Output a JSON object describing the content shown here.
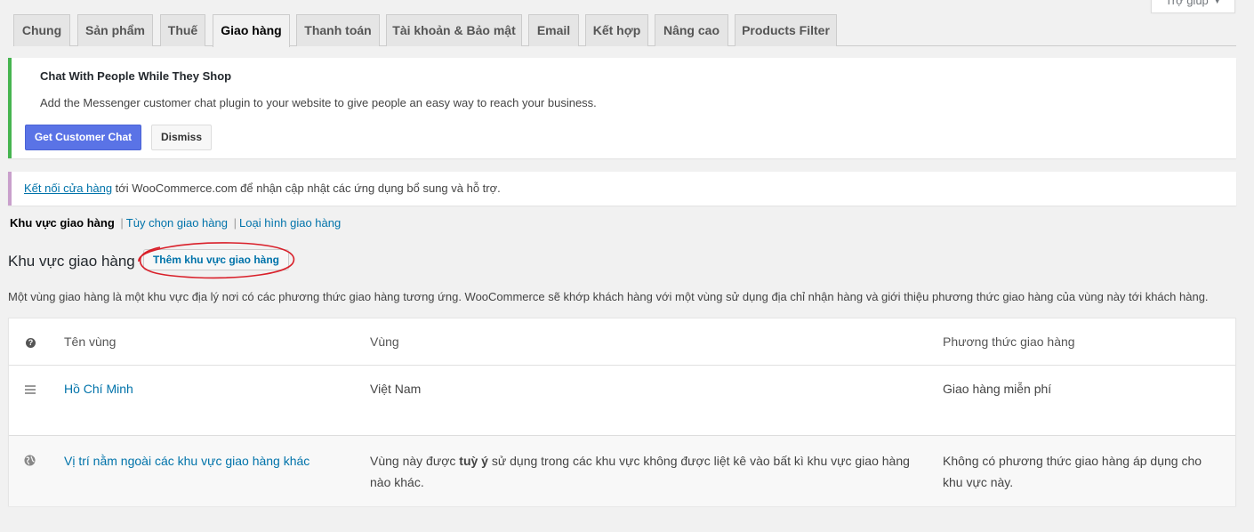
{
  "help_tab": {
    "label": "Trợ giúp"
  },
  "tabs": [
    {
      "label": "Chung",
      "active": false
    },
    {
      "label": "Sản phẩm",
      "active": false
    },
    {
      "label": "Thuế",
      "active": false
    },
    {
      "label": "Giao hàng",
      "active": true
    },
    {
      "label": "Thanh toán",
      "active": false
    },
    {
      "label": "Tài khoản & Bảo mật",
      "active": false
    },
    {
      "label": "Email",
      "active": false
    },
    {
      "label": "Kết hợp",
      "active": false
    },
    {
      "label": "Nâng cao",
      "active": false
    },
    {
      "label": "Products Filter",
      "active": false
    }
  ],
  "messenger_notice": {
    "title": "Chat With People While They Shop",
    "text": "Add the Messenger customer chat plugin to your website to give people an easy way to reach your business.",
    "primary_button": "Get Customer Chat",
    "dismiss_button": "Dismiss"
  },
  "connect_notice": {
    "link_text": "Kết nối cửa hàng",
    "text": " tới WooCommerce.com để nhận cập nhật các ứng dụng bổ sung và hỗ trợ."
  },
  "subnav": {
    "current": "Khu vực giao hàng",
    "sep": "|",
    "items": [
      "Tùy chọn giao hàng",
      "Loại hình giao hàng"
    ]
  },
  "heading": "Khu vực giao hàng",
  "add_zone_button": "Thêm khu vực giao hàng",
  "description": "Một vùng giao hàng là một khu vực địa lý nơi có các phương thức giao hàng tương ứng. WooCommerce sẽ khớp khách hàng với một vùng sử dụng địa chỉ nhận hàng và giới thiệu phương thức giao hàng của vùng này tới khách hàng.",
  "table": {
    "help_icon": "?",
    "columns": {
      "name": "Tên vùng",
      "region": "Vùng",
      "methods": "Phương thức giao hàng"
    },
    "zone": {
      "name": "Hồ Chí Minh",
      "region": "Việt Nam",
      "methods": "Giao hàng miễn phí"
    },
    "other": {
      "name": "Vị trí nằm ngoài các khu vực giao hàng khác",
      "region_before": "Vùng này được ",
      "region_bold": "tuỳ ý",
      "region_after": " sử dụng trong các khu vực không được liệt kê vào bất kì khu vực giao hàng nào khác.",
      "methods": "Không có phương thức giao hàng áp dụng cho khu vực này."
    }
  },
  "colors": {
    "link": "#0073aa",
    "primary_button": "#5a73e6",
    "annotation": "#d9202a",
    "success_border": "#46b450"
  }
}
